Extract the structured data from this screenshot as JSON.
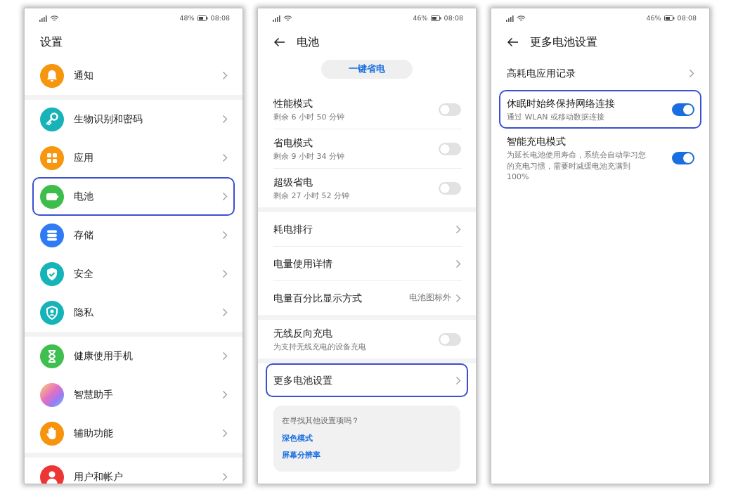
{
  "screens": [
    {
      "status": {
        "battery": "48%",
        "time": "08:08"
      },
      "back_button": false,
      "title": "设置",
      "groups": [
        {
          "items": [
            {
              "kind": "nav",
              "icon": {
                "kind": "bell",
                "color": "#f6950e"
              },
              "title": "通知",
              "highlighted": false
            }
          ]
        },
        {
          "items": [
            {
              "kind": "nav",
              "icon": {
                "kind": "key",
                "color": "#17b3b8"
              },
              "title": "生物识别和密码",
              "highlighted": false
            },
            {
              "kind": "nav",
              "icon": {
                "kind": "apps",
                "color": "#f7960f"
              },
              "title": "应用",
              "highlighted": false
            },
            {
              "kind": "nav",
              "icon": {
                "kind": "battery",
                "color": "#3dbd4c"
              },
              "title": "电池",
              "highlighted": true
            },
            {
              "kind": "nav",
              "icon": {
                "kind": "storage",
                "color": "#2f7bf5"
              },
              "title": "存储",
              "highlighted": false
            },
            {
              "kind": "nav",
              "icon": {
                "kind": "shield",
                "color": "#15b4b9"
              },
              "title": "安全",
              "highlighted": false
            },
            {
              "kind": "nav",
              "icon": {
                "kind": "privacy",
                "color": "#15b4b9"
              },
              "title": "隐私",
              "highlighted": false
            }
          ]
        },
        {
          "items": [
            {
              "kind": "nav",
              "icon": {
                "kind": "hourglass",
                "color": "#3fbf4f"
              },
              "title": "健康使用手机",
              "highlighted": false
            },
            {
              "kind": "nav",
              "icon": {
                "kind": "assistant"
              },
              "title": "智慧助手",
              "highlighted": false
            },
            {
              "kind": "nav",
              "icon": {
                "kind": "hand",
                "color": "#f7930c"
              },
              "title": "辅助功能",
              "highlighted": false
            }
          ]
        },
        {
          "items": [
            {
              "kind": "nav",
              "icon": {
                "kind": "user",
                "color": "#ee3535"
              },
              "title": "用户和帐户",
              "highlighted": false
            }
          ]
        }
      ]
    },
    {
      "status": {
        "battery": "46%",
        "time": "08:08"
      },
      "back_button": true,
      "title": "电池",
      "action_button": "一键省电",
      "groups": [
        {
          "items": [
            {
              "kind": "toggle",
              "title": "性能模式",
              "subtitle": "剩余 6 小时 50 分钟",
              "on": false,
              "highlighted": false
            },
            {
              "kind": "toggle",
              "title": "省电模式",
              "subtitle": "剩余 9 小时 34 分钟",
              "on": false,
              "highlighted": false
            },
            {
              "kind": "toggle",
              "title": "超级省电",
              "subtitle": "剩余 27 小时 52 分钟",
              "on": false,
              "highlighted": false
            }
          ]
        },
        {
          "items": [
            {
              "kind": "nav",
              "title": "耗电排行",
              "highlighted": false
            },
            {
              "kind": "nav",
              "title": "电量使用详情",
              "highlighted": false
            },
            {
              "kind": "nav",
              "title": "电量百分比显示方式",
              "value": "电池图标外",
              "highlighted": false
            }
          ]
        },
        {
          "items": [
            {
              "kind": "toggle",
              "title": "无线反向充电",
              "subtitle": "为支持无线充电的设备充电",
              "on": false,
              "highlighted": false
            }
          ]
        },
        {
          "items": [
            {
              "kind": "nav",
              "title": "更多电池设置",
              "highlighted": true
            }
          ]
        }
      ],
      "suggestions": {
        "prompt": "在寻找其他设置项吗？",
        "links": [
          "深色模式",
          "屏幕分辨率"
        ]
      }
    },
    {
      "status": {
        "battery": "46%",
        "time": "08:08"
      },
      "back_button": true,
      "title": "更多电池设置",
      "groups": [
        {
          "items": [
            {
              "kind": "nav",
              "title": "高耗电应用记录",
              "highlighted": false
            },
            {
              "kind": "toggle",
              "title": "休眠时始终保持网络连接",
              "subtitle": "通过 WLAN 或移动数据连接",
              "on": true,
              "highlighted": true
            },
            {
              "kind": "toggle",
              "title": "智能充电模式",
              "subtitle": "为延长电池使用寿命，系统会自动学习您的充电习惯，需要时减缓电池充满到 100%",
              "on": true,
              "highlighted": false
            }
          ]
        }
      ]
    }
  ]
}
